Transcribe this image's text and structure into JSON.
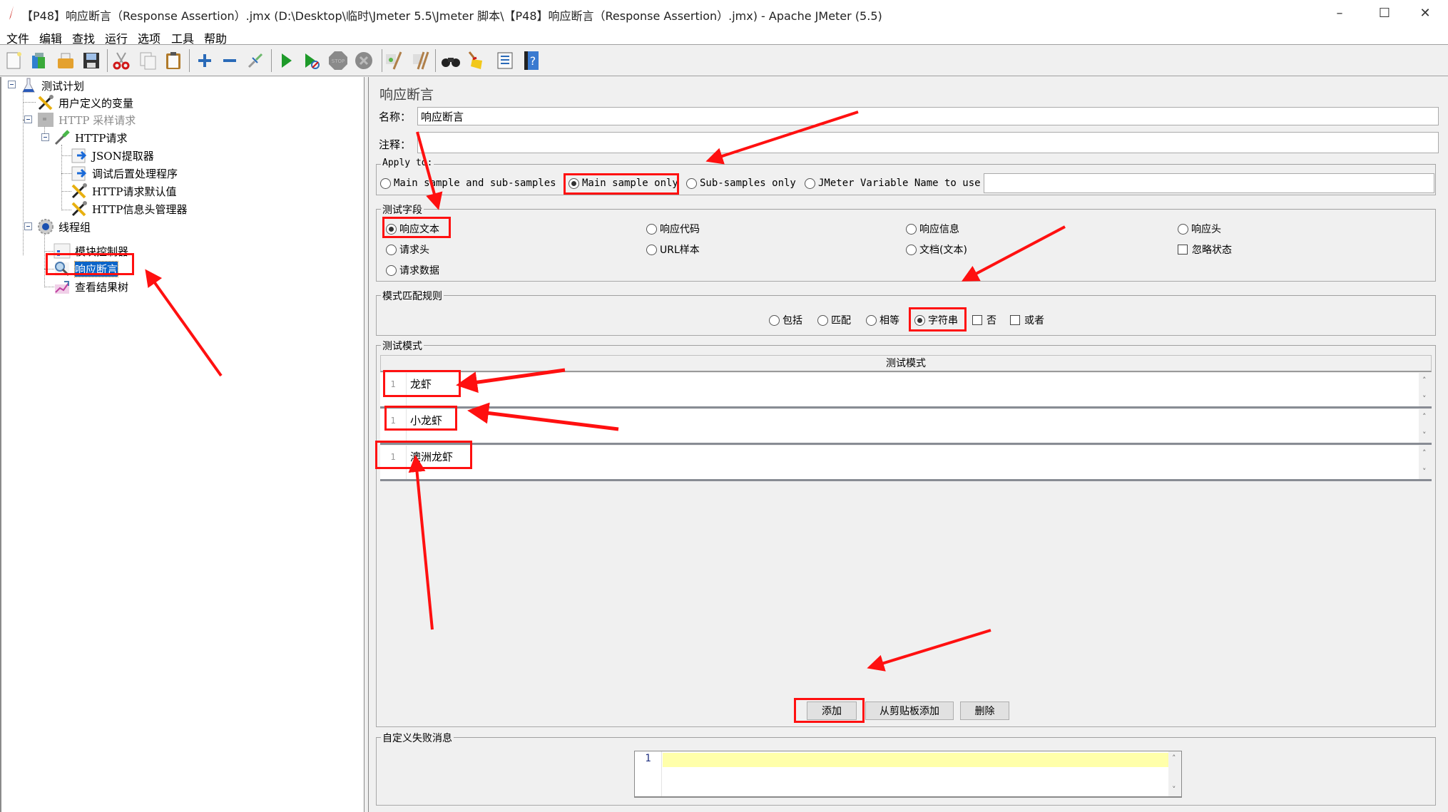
{
  "window": {
    "title": "【P48】响应断言（Response Assertion）.jmx (D:\\Desktop\\临时\\Jmeter 5.5\\Jmeter 脚本\\【P48】响应断言（Response Assertion）.jmx) - Apache JMeter (5.5)",
    "minimize": "–",
    "maximize": "☐",
    "close": "✕"
  },
  "menu": [
    "文件",
    "编辑",
    "查找",
    "运行",
    "选项",
    "工具",
    "帮助"
  ],
  "toolbar": [
    {
      "name": "new-icon",
      "glyph": "📄"
    },
    {
      "name": "templates-icon",
      "glyph": "📚"
    },
    {
      "name": "open-icon",
      "glyph": "📂"
    },
    {
      "name": "save-icon",
      "glyph": "💾"
    },
    {
      "name": "cut-icon",
      "glyph": "✂"
    },
    {
      "name": "copy-icon",
      "glyph": "❐"
    },
    {
      "name": "paste-icon",
      "glyph": "📋"
    },
    {
      "name": "expand-icon",
      "glyph": "+"
    },
    {
      "name": "collapse-icon",
      "glyph": "−"
    },
    {
      "name": "toggle-icon",
      "glyph": "⤡"
    },
    {
      "name": "start-icon",
      "glyph": "▶"
    },
    {
      "name": "start-no-pause-icon",
      "glyph": "▶"
    },
    {
      "name": "stop-icon",
      "glyph": "STOP"
    },
    {
      "name": "shutdown-icon",
      "glyph": "✖"
    },
    {
      "name": "clear-icon",
      "glyph": "🧹"
    },
    {
      "name": "clear-all-icon",
      "glyph": "🧹"
    },
    {
      "name": "search-icon",
      "glyph": "🔭"
    },
    {
      "name": "reset-search-icon",
      "glyph": "🧹"
    },
    {
      "name": "function-helper-icon",
      "glyph": "☰"
    },
    {
      "name": "help-icon",
      "glyph": "?"
    }
  ],
  "tree": [
    {
      "label": "测试计划",
      "icon": "test-plan-icon"
    },
    {
      "label": "用户定义的变量",
      "icon": "wrench-icon"
    },
    {
      "label": "HTTP  采样请求",
      "icon": "disabled-controller-icon"
    },
    {
      "label": "HTTP请求",
      "icon": "pipette-icon"
    },
    {
      "label": "JSON提取器",
      "icon": "post-processor-icon"
    },
    {
      "label": "调试后置处理程序",
      "icon": "post-processor-icon"
    },
    {
      "label": "HTTP请求默认值",
      "icon": "wrench-icon"
    },
    {
      "label": "HTTP信息头管理器",
      "icon": "wrench-icon"
    },
    {
      "label": "线程组",
      "icon": "gear-icon"
    },
    {
      "label": "模块控制器",
      "icon": "module-controller-icon"
    },
    {
      "label": "响应断言",
      "icon": "magnifier-icon"
    },
    {
      "label": "查看结果树",
      "icon": "chart-icon"
    }
  ],
  "panel": {
    "title": "响应断言",
    "name_label": "名称：",
    "name_value": "响应断言",
    "comment_label": "注释：",
    "comment_value": "",
    "apply_to": {
      "legend": "Apply to:",
      "options": [
        "Main sample and sub-samples",
        "Main sample only",
        "Sub-samples only",
        "JMeter Variable Name to use"
      ],
      "selected": "Main sample only",
      "variable_value": ""
    },
    "test_field": {
      "legend": "测试字段",
      "options": [
        "响应文本",
        "响应代码",
        "响应信息",
        "响应头",
        "请求头",
        "URL样本",
        "文档(文本)",
        "请求数据"
      ],
      "selected": "响应文本",
      "ignore_status_label": "忽略状态",
      "ignore_status_checked": false
    },
    "match_rules": {
      "legend": "模式匹配规则",
      "options": [
        "包括",
        "匹配",
        "相等",
        "字符串"
      ],
      "selected": "字符串",
      "not_label": "否",
      "not_checked": false,
      "or_label": "或者",
      "or_checked": false
    },
    "patterns": {
      "legend": "测试模式",
      "column_header": "测试模式",
      "rows": [
        {
          "line": "1",
          "text": "龙虾"
        },
        {
          "line": "1",
          "text": "小龙虾"
        },
        {
          "line": "1",
          "text": "澳洲龙虾"
        }
      ],
      "add_button": "添加",
      "add_clipboard_button": "从剪贴板添加",
      "delete_button": "删除"
    },
    "failure_message": {
      "legend": "自定义失败消息",
      "line": "1",
      "value": ""
    }
  },
  "annotation_color": "#ff1010"
}
